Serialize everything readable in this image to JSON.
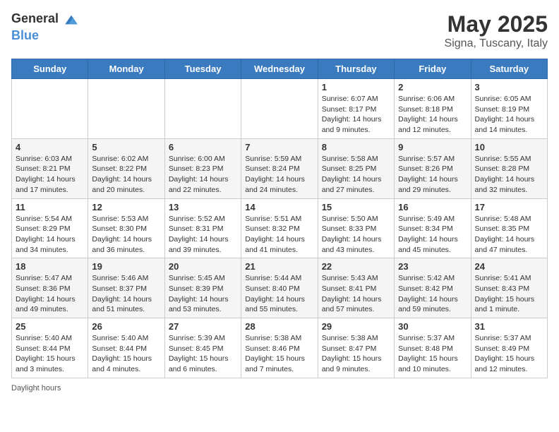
{
  "header": {
    "logo_general": "General",
    "logo_blue": "Blue",
    "month": "May 2025",
    "location": "Signa, Tuscany, Italy"
  },
  "weekdays": [
    "Sunday",
    "Monday",
    "Tuesday",
    "Wednesday",
    "Thursday",
    "Friday",
    "Saturday"
  ],
  "weeks": [
    [
      {
        "day": "",
        "info": ""
      },
      {
        "day": "",
        "info": ""
      },
      {
        "day": "",
        "info": ""
      },
      {
        "day": "",
        "info": ""
      },
      {
        "day": "1",
        "info": "Sunrise: 6:07 AM\nSunset: 8:17 PM\nDaylight: 14 hours and 9 minutes."
      },
      {
        "day": "2",
        "info": "Sunrise: 6:06 AM\nSunset: 8:18 PM\nDaylight: 14 hours and 12 minutes."
      },
      {
        "day": "3",
        "info": "Sunrise: 6:05 AM\nSunset: 8:19 PM\nDaylight: 14 hours and 14 minutes."
      }
    ],
    [
      {
        "day": "4",
        "info": "Sunrise: 6:03 AM\nSunset: 8:21 PM\nDaylight: 14 hours and 17 minutes."
      },
      {
        "day": "5",
        "info": "Sunrise: 6:02 AM\nSunset: 8:22 PM\nDaylight: 14 hours and 20 minutes."
      },
      {
        "day": "6",
        "info": "Sunrise: 6:00 AM\nSunset: 8:23 PM\nDaylight: 14 hours and 22 minutes."
      },
      {
        "day": "7",
        "info": "Sunrise: 5:59 AM\nSunset: 8:24 PM\nDaylight: 14 hours and 24 minutes."
      },
      {
        "day": "8",
        "info": "Sunrise: 5:58 AM\nSunset: 8:25 PM\nDaylight: 14 hours and 27 minutes."
      },
      {
        "day": "9",
        "info": "Sunrise: 5:57 AM\nSunset: 8:26 PM\nDaylight: 14 hours and 29 minutes."
      },
      {
        "day": "10",
        "info": "Sunrise: 5:55 AM\nSunset: 8:28 PM\nDaylight: 14 hours and 32 minutes."
      }
    ],
    [
      {
        "day": "11",
        "info": "Sunrise: 5:54 AM\nSunset: 8:29 PM\nDaylight: 14 hours and 34 minutes."
      },
      {
        "day": "12",
        "info": "Sunrise: 5:53 AM\nSunset: 8:30 PM\nDaylight: 14 hours and 36 minutes."
      },
      {
        "day": "13",
        "info": "Sunrise: 5:52 AM\nSunset: 8:31 PM\nDaylight: 14 hours and 39 minutes."
      },
      {
        "day": "14",
        "info": "Sunrise: 5:51 AM\nSunset: 8:32 PM\nDaylight: 14 hours and 41 minutes."
      },
      {
        "day": "15",
        "info": "Sunrise: 5:50 AM\nSunset: 8:33 PM\nDaylight: 14 hours and 43 minutes."
      },
      {
        "day": "16",
        "info": "Sunrise: 5:49 AM\nSunset: 8:34 PM\nDaylight: 14 hours and 45 minutes."
      },
      {
        "day": "17",
        "info": "Sunrise: 5:48 AM\nSunset: 8:35 PM\nDaylight: 14 hours and 47 minutes."
      }
    ],
    [
      {
        "day": "18",
        "info": "Sunrise: 5:47 AM\nSunset: 8:36 PM\nDaylight: 14 hours and 49 minutes."
      },
      {
        "day": "19",
        "info": "Sunrise: 5:46 AM\nSunset: 8:37 PM\nDaylight: 14 hours and 51 minutes."
      },
      {
        "day": "20",
        "info": "Sunrise: 5:45 AM\nSunset: 8:39 PM\nDaylight: 14 hours and 53 minutes."
      },
      {
        "day": "21",
        "info": "Sunrise: 5:44 AM\nSunset: 8:40 PM\nDaylight: 14 hours and 55 minutes."
      },
      {
        "day": "22",
        "info": "Sunrise: 5:43 AM\nSunset: 8:41 PM\nDaylight: 14 hours and 57 minutes."
      },
      {
        "day": "23",
        "info": "Sunrise: 5:42 AM\nSunset: 8:42 PM\nDaylight: 14 hours and 59 minutes."
      },
      {
        "day": "24",
        "info": "Sunrise: 5:41 AM\nSunset: 8:43 PM\nDaylight: 15 hours and 1 minute."
      }
    ],
    [
      {
        "day": "25",
        "info": "Sunrise: 5:40 AM\nSunset: 8:44 PM\nDaylight: 15 hours and 3 minutes."
      },
      {
        "day": "26",
        "info": "Sunrise: 5:40 AM\nSunset: 8:44 PM\nDaylight: 15 hours and 4 minutes."
      },
      {
        "day": "27",
        "info": "Sunrise: 5:39 AM\nSunset: 8:45 PM\nDaylight: 15 hours and 6 minutes."
      },
      {
        "day": "28",
        "info": "Sunrise: 5:38 AM\nSunset: 8:46 PM\nDaylight: 15 hours and 7 minutes."
      },
      {
        "day": "29",
        "info": "Sunrise: 5:38 AM\nSunset: 8:47 PM\nDaylight: 15 hours and 9 minutes."
      },
      {
        "day": "30",
        "info": "Sunrise: 5:37 AM\nSunset: 8:48 PM\nDaylight: 15 hours and 10 minutes."
      },
      {
        "day": "31",
        "info": "Sunrise: 5:37 AM\nSunset: 8:49 PM\nDaylight: 15 hours and 12 minutes."
      }
    ]
  ],
  "footer": {
    "daylight_label": "Daylight hours"
  }
}
